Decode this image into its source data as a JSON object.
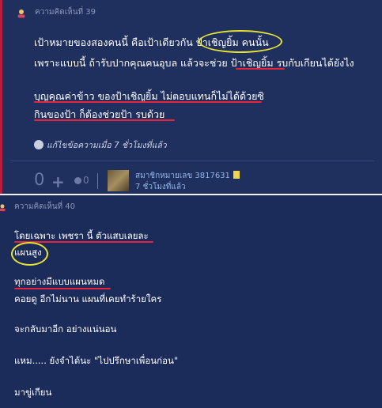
{
  "comment39": {
    "header": "ความคิดเห็นที่ 39",
    "lines": [
      "เป้าหมายของสองคนนี้ คือเป้าเดียวกัน ป้าเชิญยิ้ม คนนั้น",
      "เพราะแบบนี้ ถ้ารับปากคุณคนอุบล แล้วจะช่วย ป้าเชิญยิ้ม รบกับเกียนได้ยังไง",
      "บุญคุณค่าข้าว ของป้าเชิญยิ้ม ไม่ตอบแทนก็ไม่ได้ด้วยซิ",
      "กินของป้า ก็ต้องช่วยป้า รบด้วย"
    ],
    "edit_note": "แก้ไขข้อความเมื่อ 7 ชั่วโมงที่แล้ว",
    "vote_count": "0",
    "plus_symbol": "+",
    "emotion_count": "0",
    "member_name": "สมาชิกหมายเลข 3817631",
    "member_time": "7 ชั่วโมงที่แล้ว"
  },
  "comment40": {
    "header": "ความคิดเห็นที่ 40",
    "lines": [
      "โดยเฉพาะ เพชรา นี้ ตัวแสบเลยละ",
      "แผนสูง",
      "ทุกอย่างมีแบบแผนหมด",
      "คอยดู อีกไม่นาน แผนที่เคยทำร้ายใคร",
      "จะกลับมาอีก อย่างแน่นอน",
      "แหม..... ยังจำได้นะ \"ไปปรึกษาเพื่อนก่อน\"",
      "มาขู่เกียน"
    ]
  },
  "colors": {
    "panel_bg": "#1f2f5e",
    "text": "#ffffff",
    "underline_annotation": "#e8233c",
    "circle_annotation": "#e6e231",
    "accent_left_border": "#b81d3c"
  }
}
